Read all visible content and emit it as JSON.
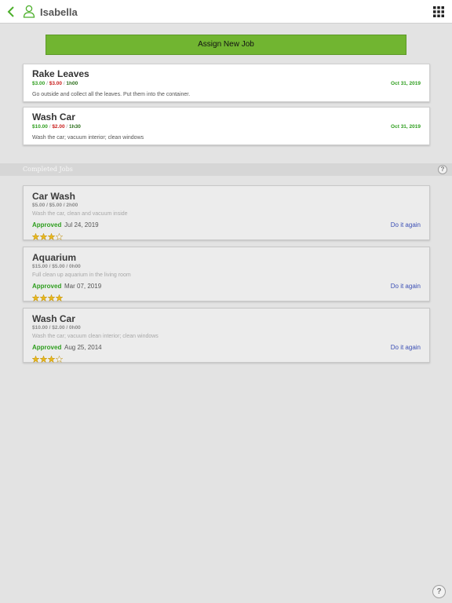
{
  "header": {
    "back_icon": "chevron-left-icon",
    "user_icon": "person-icon",
    "title": "Isabella",
    "menu_icon": "grid-icon"
  },
  "assign_button": {
    "label": "Assign New Job"
  },
  "active_jobs": [
    {
      "title": "Rake Leaves",
      "reward": "$3.00",
      "penalty": "$3.00",
      "duration": "1h00",
      "date": "Oct 31, 2019",
      "description": "Go outside and collect all the leaves. Put them into the container."
    },
    {
      "title": "Wash Car",
      "reward": "$10.00",
      "penalty": "$2.00",
      "duration": "1h30",
      "date": "Oct 31, 2019",
      "description": "Wash the car; vacuum interior; clean windows"
    }
  ],
  "completed_section": {
    "title": "Completed Jobs",
    "help_icon": "help-icon"
  },
  "completed_jobs": [
    {
      "title": "Car Wash",
      "meta": "$5.00 / $5.00 / 2h00",
      "description": "Wash the car, clean and vacuum inside",
      "status": "Approved",
      "date": "Jul 24, 2019",
      "action": "Do it again",
      "rating": 3,
      "rating_max": 4
    },
    {
      "title": "Aquarium",
      "meta": "$15.00 / $5.00 / 0h00",
      "description": "Full clean up aquarium in the living room",
      "status": "Approved",
      "date": "Mar 07, 2019",
      "action": "Do it again",
      "rating": 4,
      "rating_max": 4
    },
    {
      "title": "Wash Car",
      "meta": "$10.00 / $2.00 / 0h00",
      "description": "Wash the car; vacuum clean interior; clean windows",
      "status": "Approved",
      "date": "Aug 25, 2014",
      "action": "Do it again",
      "rating": 3,
      "rating_max": 4
    }
  ],
  "colors": {
    "accent_green": "#71b531",
    "reward_green": "#2e9e1e",
    "penalty_red": "#c9201e",
    "link_blue": "#3b4fb5",
    "star_gold": "#e8b81f"
  }
}
